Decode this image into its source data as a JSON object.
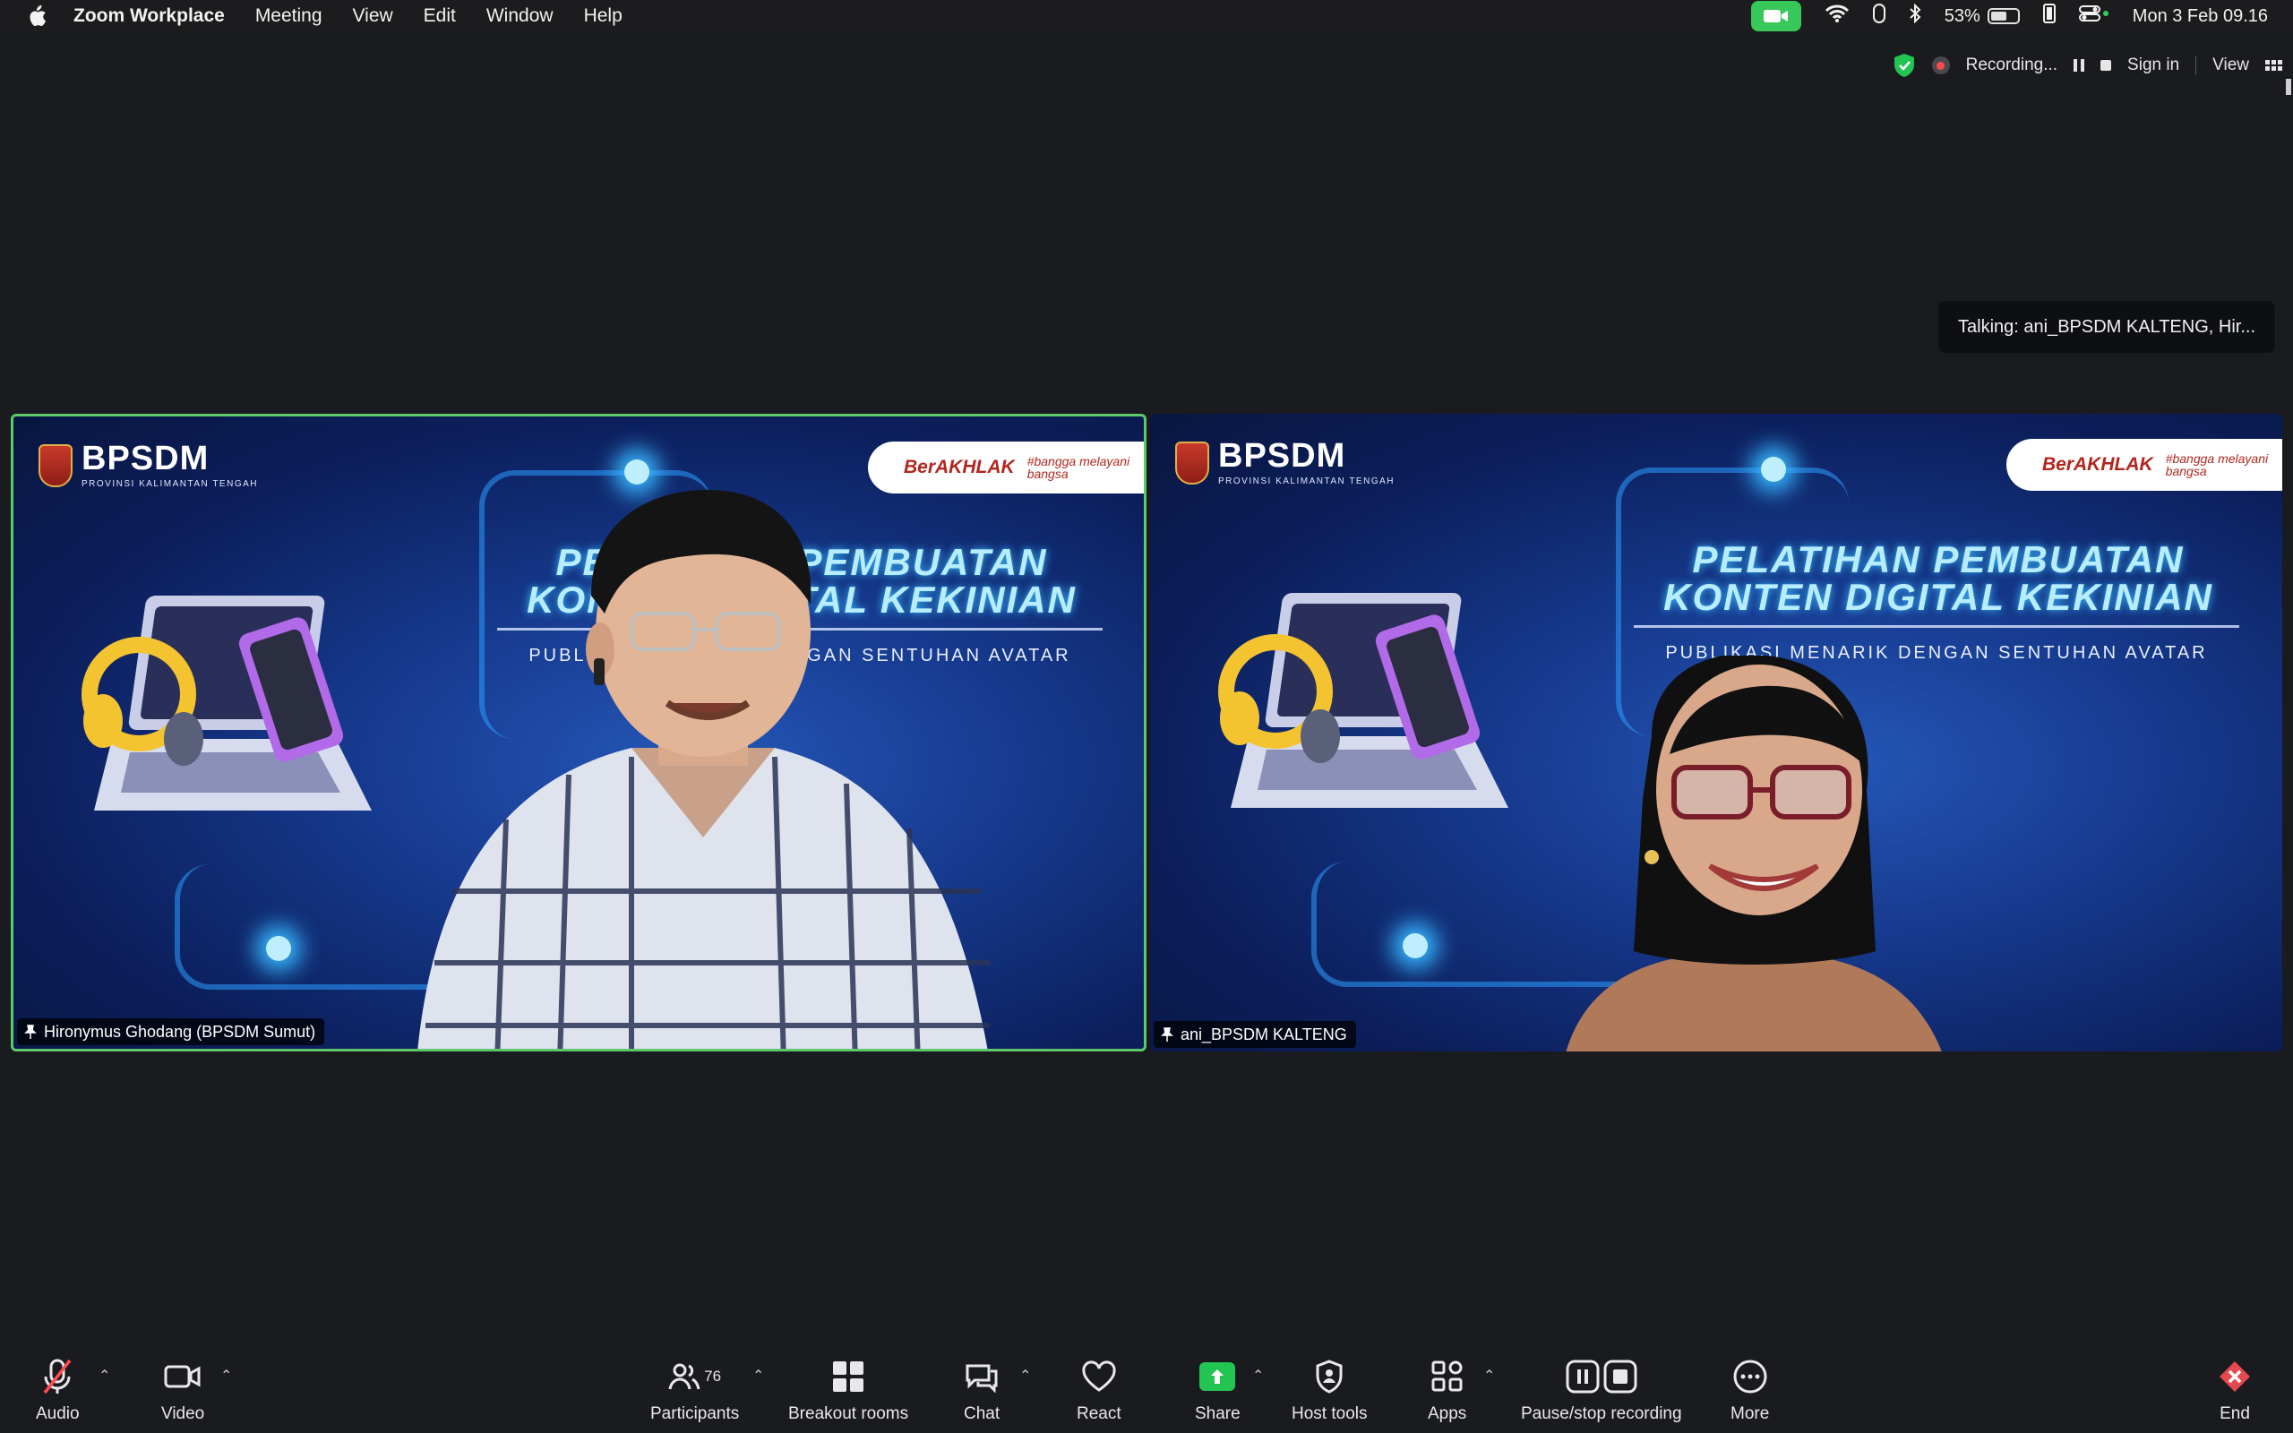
{
  "menubar": {
    "app_name": "Zoom Workplace",
    "menus": [
      "Meeting",
      "View",
      "Edit",
      "Window",
      "Help"
    ],
    "battery_percent": "53%",
    "datetime": "Mon 3 Feb  09.16"
  },
  "topstrip": {
    "recording_label": "Recording...",
    "sign_in": "Sign in",
    "view": "View"
  },
  "talking": "Talking: ani_BPSDM KALTENG, Hir...",
  "slide": {
    "org": "BPSDM",
    "org_sub": "PROVINSI KALIMANTAN TENGAH",
    "badge_main": "BerAKHLAK",
    "badge_side": "#bangga melayani bangsa",
    "headline_1": "PELATIHAN PEMBUATAN",
    "headline_2": "KONTEN DIGITAL KEKINIAN",
    "subhead": "PUBLIKASI MENARIK DENGAN SENTUHAN AVATAR"
  },
  "tiles": [
    {
      "name": "Hironymus Ghodang (BPSDM Sumut)",
      "active_speaker": true
    },
    {
      "name": "ani_BPSDM KALTENG",
      "active_speaker": false
    }
  ],
  "toolbar": {
    "audio": "Audio",
    "video": "Video",
    "participants": "Participants",
    "participants_count": "76",
    "breakout": "Breakout rooms",
    "chat": "Chat",
    "react": "React",
    "share": "Share",
    "host_tools": "Host tools",
    "apps": "Apps",
    "pause_stop": "Pause/stop recording",
    "more": "More",
    "end": "End"
  },
  "colors": {
    "active_speaker_border": "#5cc96a",
    "share_green": "#23c552",
    "end_red": "#e5484d",
    "camera_pill": "#38c85a"
  }
}
